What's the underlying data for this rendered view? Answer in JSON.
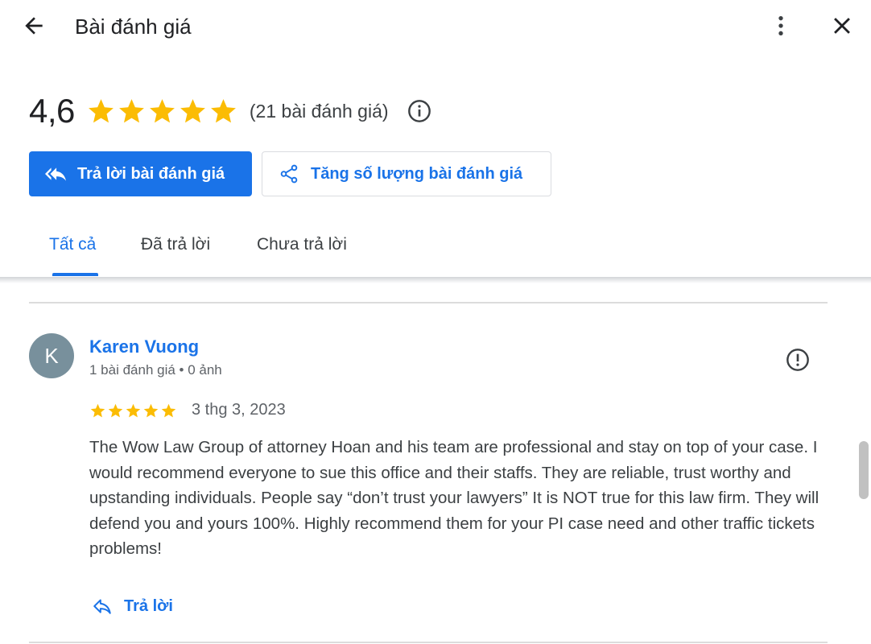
{
  "header": {
    "title": "Bài đánh giá",
    "back_icon": "arrow-back-icon",
    "more_icon": "more-vert-icon",
    "close_icon": "close-icon"
  },
  "summary": {
    "average": "4,6",
    "stars": 5,
    "count_text": "(21 bài đánh giá)",
    "star_color": "#fbbc04",
    "info_icon": "info-icon"
  },
  "actions": {
    "reply_reviews": "Trả lời bài đánh giá",
    "get_more_reviews": "Tăng số lượng bài đánh giá",
    "accent_color": "#1a73e8"
  },
  "tabs": [
    {
      "label": "Tất cả",
      "active": true
    },
    {
      "label": "Đã trả lời",
      "active": false
    },
    {
      "label": "Chưa trả lời",
      "active": false
    }
  ],
  "review": {
    "avatar_letter": "K",
    "author": "Karen Vuong",
    "meta": "1 bài đánh giá • 0 ảnh",
    "rating": 5,
    "date": "3 thg 3, 2023",
    "text": "The Wow Law Group of attorney Hoan and his team are professional and stay on top of your case. I would recommend everyone to sue this office and their staffs. They are reliable, trust worthy and upstanding individuals. People say “don’t trust your lawyers” It is NOT true for this law firm. They will defend you and yours 100%. Highly recommend them for your PI case need and other traffic tickets problems!",
    "reply_label": "Trả lời",
    "report_icon": "report-icon"
  }
}
